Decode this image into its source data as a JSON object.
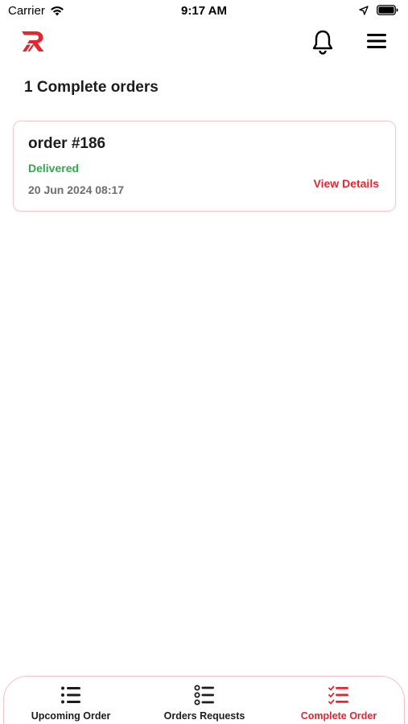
{
  "status_bar": {
    "carrier": "Carrier",
    "time": "9:17 AM"
  },
  "header": {
    "logo_icon": "brand-r-logo",
    "notification_icon": "bell-icon",
    "menu_icon": "hamburger-menu-icon"
  },
  "page": {
    "title": "1 Complete orders"
  },
  "orders": [
    {
      "number": "order #186",
      "status": "Delivered",
      "date": "20 Jun 2024 08:17",
      "action": "View Details"
    }
  ],
  "tabs": [
    {
      "label": "Upcoming Order",
      "icon": "list-icon",
      "active": false
    },
    {
      "label": "Orders Requests",
      "icon": "list-bullets-icon",
      "active": false
    },
    {
      "label": "Complete Order",
      "icon": "checklist-icon",
      "active": true
    }
  ],
  "colors": {
    "accent": "#e3262f",
    "success": "#2eaa4a",
    "muted": "#6e6e72",
    "card_border": "#f1c9cd"
  }
}
